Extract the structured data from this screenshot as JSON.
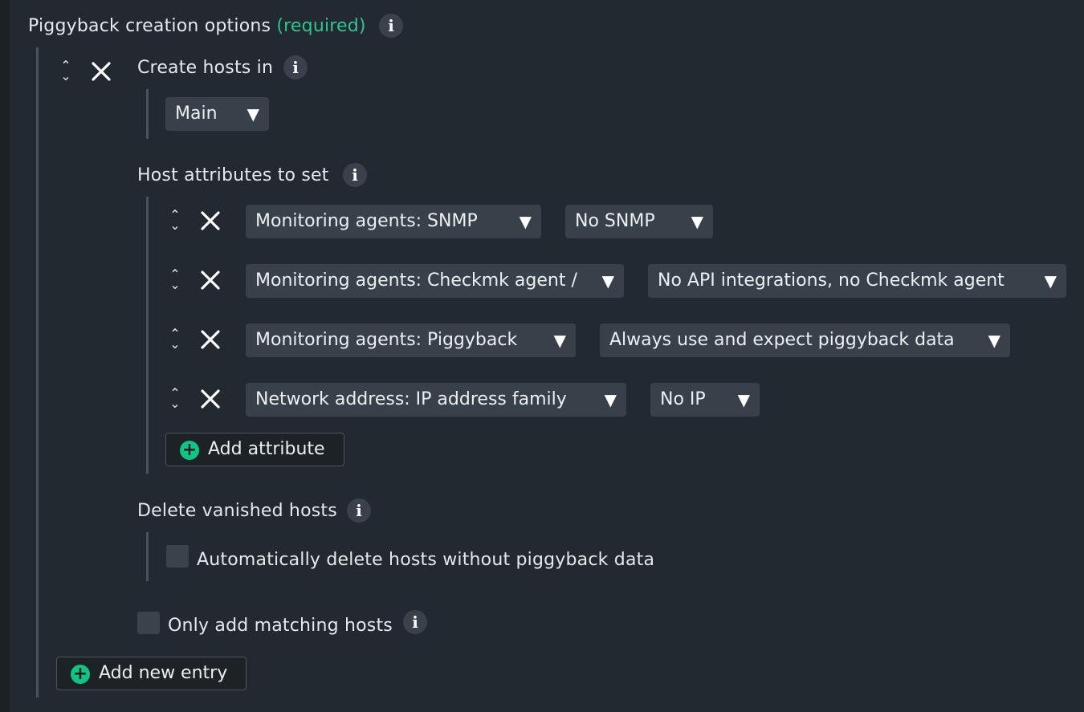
{
  "section": {
    "title": "Piggyback creation options",
    "required_label": "(required)",
    "info_icon": "info-icon"
  },
  "entry": {
    "create_hosts_in": {
      "label": "Create hosts in",
      "value": "Main"
    },
    "host_attributes": {
      "label": "Host attributes to set",
      "rows": [
        {
          "attribute": "Monitoring agents: SNMP",
          "value": "No SNMP"
        },
        {
          "attribute": "Monitoring agents: Checkmk agent /",
          "value": "No API integrations, no Checkmk agent"
        },
        {
          "attribute": "Monitoring agents: Piggyback",
          "value": "Always use and expect piggyback data"
        },
        {
          "attribute": "Network address: IP address family",
          "value": "No IP"
        }
      ],
      "add_button": "Add attribute"
    },
    "delete_vanished": {
      "label": "Delete vanished hosts",
      "checkbox_label": "Automatically delete hosts without piggyback data",
      "checked": false
    },
    "only_matching": {
      "label": "Only add matching hosts",
      "checked": false
    }
  },
  "add_entry_button": "Add new entry",
  "colors": {
    "background": "#232930",
    "required": "#2fc591",
    "plus_icon": "#13c383",
    "dropdown": "#38404a"
  }
}
